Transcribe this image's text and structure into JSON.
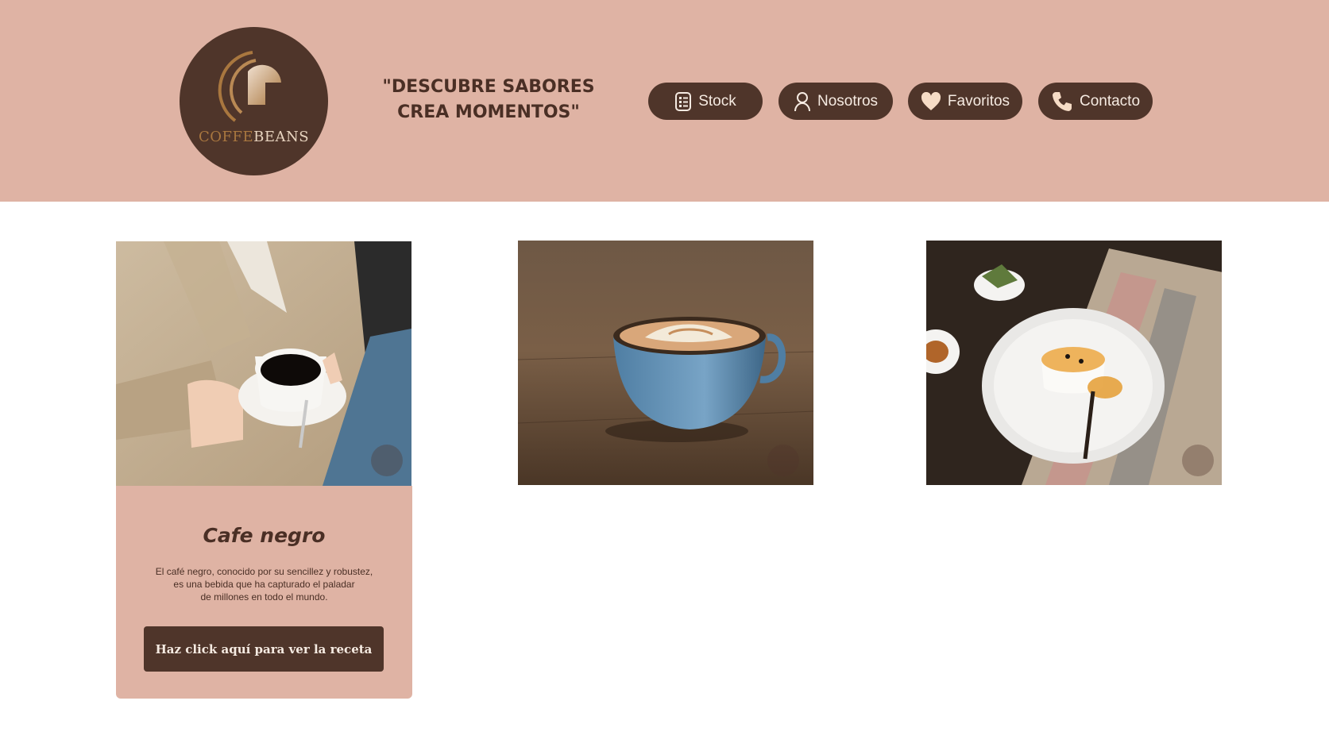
{
  "brand": {
    "logo_word1": "COFFE",
    "logo_word2": "BEANS"
  },
  "header": {
    "slogan_line1": "\"DESCUBRE SABORES",
    "slogan_line2": "CREA MOMENTOS\""
  },
  "nav": [
    {
      "label": "Stock",
      "icon": "list-icon"
    },
    {
      "label": "Nosotros",
      "icon": "user-icon"
    },
    {
      "label": "Favoritos",
      "icon": "heart-icon"
    },
    {
      "label": "Contacto",
      "icon": "phone-icon"
    }
  ],
  "products": [
    {
      "image": "black-coffee-cup-photo"
    },
    {
      "image": "latte-art-blue-cup-photo"
    },
    {
      "image": "dessert-plate-photo"
    }
  ],
  "featured": {
    "title": "Cafe negro",
    "description_line1": "El café negro, conocido por su sencillez y robustez,",
    "description_line2": "es una bebida que ha capturado el paladar",
    "description_line3": "de millones en todo el mundo.",
    "button_label": "Haz click aquí para ver la receta"
  },
  "colors": {
    "header_bg": "#dfb3a4",
    "brand_dark": "#4f352a",
    "accent_gold": "#a9773f"
  }
}
